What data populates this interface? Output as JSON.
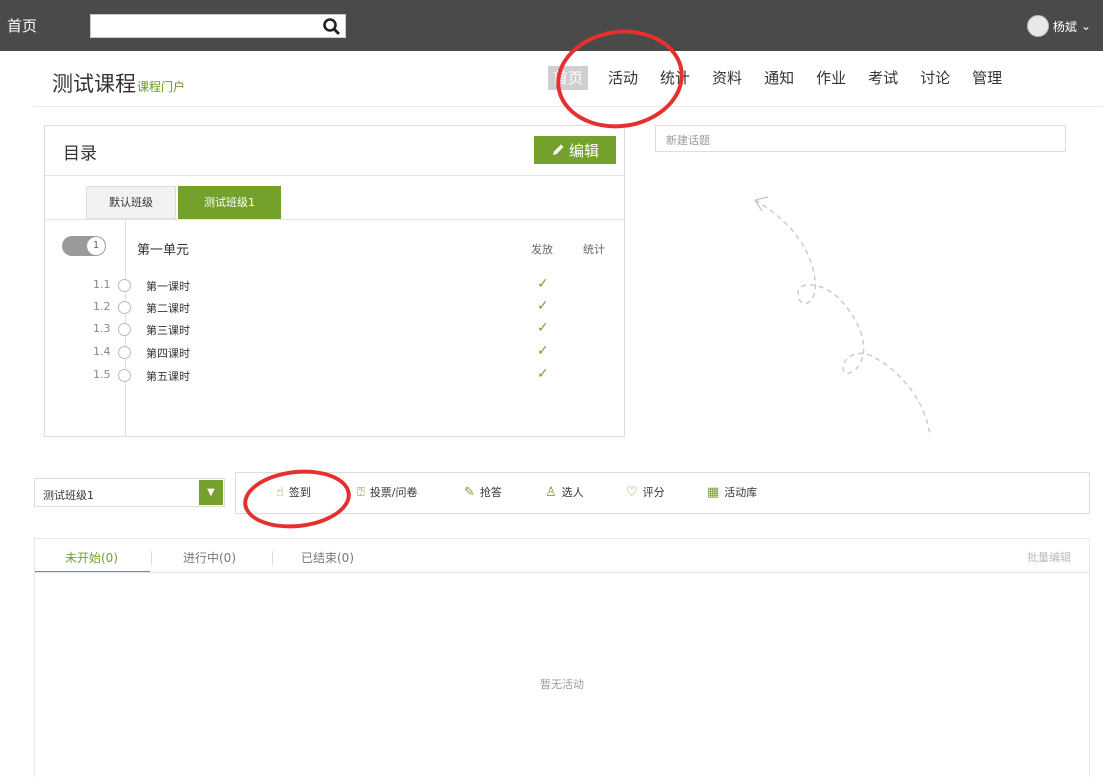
{
  "topbar": {
    "home_label": "首页",
    "search_placeholder": "",
    "user_name": "杨斌",
    "user_caret": "⌄"
  },
  "course": {
    "title": "测试课程",
    "portal_label": "课程门户"
  },
  "nav": {
    "items": [
      "首页",
      "活动",
      "统计",
      "资料",
      "通知",
      "作业",
      "考试",
      "讨论",
      "管理"
    ],
    "active_index": 0
  },
  "catalog": {
    "title": "目录",
    "edit_label": "编辑",
    "class_tabs": [
      "默认班级",
      "测试班级1"
    ],
    "active_class_tab": 1,
    "unit": {
      "toggle_number": "1",
      "name": "第一单元",
      "columns": [
        "发放",
        "统计"
      ]
    },
    "lessons": [
      {
        "num": "1.1",
        "name": "第一课时",
        "released": "✓"
      },
      {
        "num": "1.2",
        "name": "第二课时",
        "released": "✓"
      },
      {
        "num": "1.3",
        "name": "第三课时",
        "released": "✓"
      },
      {
        "num": "1.4",
        "name": "第四课时",
        "released": "✓"
      },
      {
        "num": "1.5",
        "name": "第五课时",
        "released": "✓"
      }
    ]
  },
  "topic": {
    "placeholder": "新建话题"
  },
  "activity": {
    "class_select_value": "测试班级1",
    "tools": [
      {
        "icon": "hand-pointer-icon",
        "label": "签到"
      },
      {
        "icon": "question-box-icon",
        "label": "投票/问卷"
      },
      {
        "icon": "microphone-icon",
        "label": "抢答"
      },
      {
        "icon": "person-icon",
        "label": "选人"
      },
      {
        "icon": "badge-icon",
        "label": "评分"
      },
      {
        "icon": "grid-icon",
        "label": "活动库"
      }
    ],
    "tabs": [
      "未开始(0)",
      "进行中(0)",
      "已结束(0)"
    ],
    "active_tab": 0,
    "batch_edit_label": "批量编辑",
    "empty_text": "暂无活动"
  },
  "colors": {
    "accent": "#74a12c",
    "topbar": "#4a4a4a",
    "annotation": "#e53030"
  }
}
